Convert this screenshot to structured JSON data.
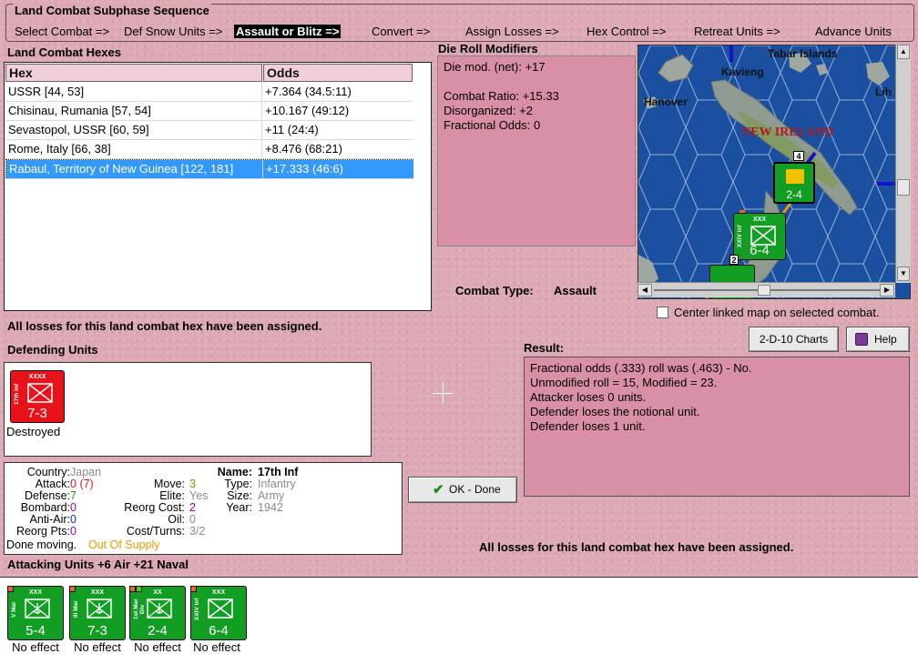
{
  "phase": {
    "title": "Land Combat Subphase Sequence",
    "steps": [
      "Select Combat =>",
      "Def Snow Units =>",
      "Assault or Blitz =>",
      "Convert =>",
      "Assign Losses =>",
      "Hex Control =>",
      "Retreat Units =>",
      "Advance Units"
    ],
    "active_index": 2
  },
  "hexes": {
    "title": "Land Combat Hexes",
    "headers": [
      "Hex",
      "Odds"
    ],
    "rows": [
      {
        "hex": "USSR [44, 53]",
        "odds": "+7.364 (34.5:11)"
      },
      {
        "hex": "Chisinau, Rumania [57, 54]",
        "odds": "+10.167 (49:12)"
      },
      {
        "hex": "Sevastopol, USSR [60, 59]",
        "odds": "+11 (24:4)"
      },
      {
        "hex": "Rome, Italy [66, 38]",
        "odds": "+8.476 (68:21)"
      },
      {
        "hex": "Rabaul, Territory of New Guinea [122, 181]",
        "odds": "+17.333 (46:6)"
      }
    ],
    "selected_index": 4
  },
  "drm": {
    "title": "Die Roll Modifiers",
    "lines": [
      "Die mod. (net): +17",
      "",
      "Combat Ratio: +15.33",
      "Disorganized: +2",
      "Fractional Odds: 0"
    ]
  },
  "map": {
    "labels": {
      "tabar": "Tabar Islands",
      "kavieng": "Kavieng",
      "hanover": "Hanover",
      "lih": "Lih",
      "new_ireland": "NEW IRELAND"
    },
    "units": [
      {
        "str": "2-4",
        "type": "XX"
      },
      {
        "str": "6-4",
        "type": "XXX",
        "side": "XXIV Inf"
      }
    ],
    "stack_counts": [
      "4",
      "2"
    ]
  },
  "combat_type": {
    "label": "Combat Type:",
    "value": "Assault"
  },
  "center_map": {
    "label": "Center linked map on selected combat.",
    "checked": false
  },
  "status_msg": "All losses for this land combat hex have been assigned.",
  "buttons": {
    "charts": "2-D-10 Charts",
    "help": "Help",
    "ok": "OK - Done"
  },
  "result": {
    "title": "Result:",
    "lines": [
      "Fractional odds (.333) roll was (.463)  - No.",
      "Unmodified roll = 15, Modified = 23.",
      "Attacker loses 0 units.",
      "Defender loses the notional unit.",
      "Defender loses 1 unit."
    ]
  },
  "defending": {
    "title": "Defending Units",
    "units": [
      {
        "size": "XXXX",
        "side": "17th Inf",
        "str": "7-3",
        "caption": "Destroyed",
        "color": "#e8121b"
      }
    ]
  },
  "unit_info": {
    "country_label": "Country:",
    "country": "Japan",
    "attack_label": "Attack:",
    "attack": "0",
    "attack_orig": "(7)",
    "defense_label": "Defense:",
    "defense": "7",
    "bombard_label": "Bombard:",
    "bombard": "0",
    "antiair_label": "Anti-Air:",
    "antiair": "0",
    "reorgpts_label": "Reorg Pts:",
    "reorgpts": "0",
    "move_label": "Move:",
    "move": "3",
    "elite_label": "Elite:",
    "elite": "Yes",
    "reorgcost_label": "Reorg Cost:",
    "reorgcost": "2",
    "oil_label": "Oil:",
    "oil": "0",
    "costturns_label": "Cost/Turns:",
    "costturns": "3/2",
    "name_label": "Name:",
    "name": "17th Inf",
    "type_label": "Type:",
    "type": "Infantry",
    "size_label": "Size:",
    "size": "Army",
    "year_label": "Year:",
    "year": "1942",
    "done_label": "Done moving.",
    "supply": "Out Of Supply"
  },
  "attacking": {
    "title": "Attacking Units +6 Air +21 Naval",
    "units": [
      {
        "size": "XXX",
        "side": "V Mar",
        "str": "5-4",
        "caption": "No effect"
      },
      {
        "size": "XXX",
        "side": "III Mar",
        "str": "7-3",
        "caption": "No effect"
      },
      {
        "size": "XX",
        "side": "1st Mar Div",
        "str": "2-4",
        "caption": "No effect"
      },
      {
        "size": "XXX",
        "side": "XXIV Inf",
        "str": "6-4",
        "caption": "No effect"
      }
    ]
  },
  "colors": {
    "background": "#dca9b4",
    "panel_pink": "#d98fa6",
    "selection": "#3399ff",
    "axis_red": "#e8121b",
    "allied_green": "#129e23",
    "grey_text": "#8a8a8a",
    "olive_text": "#9c8c00",
    "orange_text": "#e89a00",
    "purple_text": "#a000a0",
    "blue_text": "#1a1adb"
  }
}
